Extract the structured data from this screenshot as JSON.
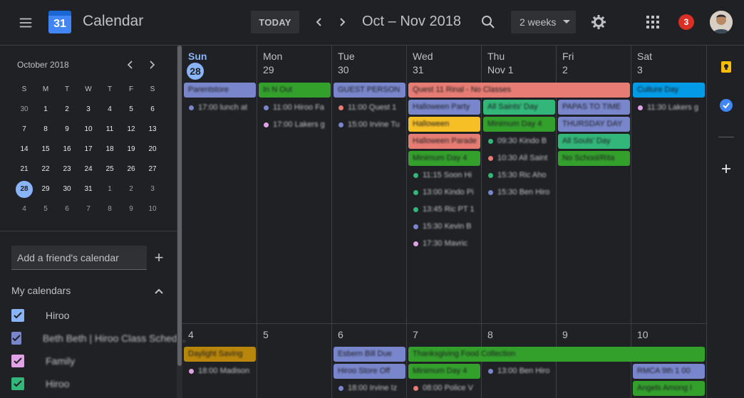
{
  "header": {
    "logo_day": "31",
    "app_title": "Calendar",
    "today_label": "TODAY",
    "date_range": "Oct – Nov 2018",
    "view_label": "2 weeks",
    "notification_count": "3"
  },
  "mini_calendar": {
    "title": "October 2018",
    "weekdays": [
      "S",
      "M",
      "T",
      "W",
      "T",
      "F",
      "S"
    ],
    "weeks": [
      [
        "30",
        "1",
        "2",
        "3",
        "4",
        "5",
        "6"
      ],
      [
        "7",
        "8",
        "9",
        "10",
        "11",
        "12",
        "13"
      ],
      [
        "14",
        "15",
        "16",
        "17",
        "18",
        "19",
        "20"
      ],
      [
        "21",
        "22",
        "23",
        "24",
        "25",
        "26",
        "27"
      ],
      [
        "28",
        "29",
        "30",
        "31",
        "1",
        "2",
        "3"
      ],
      [
        "4",
        "5",
        "6",
        "7",
        "8",
        "9",
        "10"
      ]
    ],
    "today": "28"
  },
  "sidebar": {
    "friend_placeholder": "Add a friend's calendar",
    "my_calendars_title": "My calendars",
    "calendars": [
      {
        "label": "Hiroo",
        "color": "#8ab4f8"
      },
      {
        "label": "Beth Beth | Hiroo Class Sched...",
        "color": "#7986cb"
      },
      {
        "label": "Family",
        "color": "#e1a3e5"
      },
      {
        "label": "Hiroo",
        "color": "#33b679"
      }
    ]
  },
  "week1": {
    "days": [
      {
        "dow": "Sun",
        "num": "28"
      },
      {
        "dow": "Mon",
        "num": "29"
      },
      {
        "dow": "Tue",
        "num": "30"
      },
      {
        "dow": "Wed",
        "num": "31"
      },
      {
        "dow": "Thu",
        "num": "Nov 1"
      },
      {
        "dow": "Fri",
        "num": "2"
      },
      {
        "dow": "Sat",
        "num": "3"
      }
    ],
    "events": [
      {
        "text": "Parentstore",
        "color": "#7986cb"
      },
      {
        "text": "In N Out",
        "color": "#33a02c"
      },
      {
        "text": "GUEST PERSON",
        "color": "#7986cb"
      },
      {
        "text": "Quest 11 Rinal - No Classes",
        "color": "#e67c73"
      },
      {
        "text": "Halloween Party",
        "color": "#7986cb"
      },
      {
        "text": "All Saints' Day",
        "color": "#33b679"
      },
      {
        "text": "PAPAS TO TIME",
        "color": "#7986cb"
      },
      {
        "text": "Culture Day",
        "color": "#039be5"
      },
      {
        "text": "Halloween",
        "color": "#f6bf26"
      },
      {
        "text": "Minimum Day 4",
        "color": "#33a02c"
      },
      {
        "text": "THURSDAY DAY",
        "color": "#7986cb"
      },
      {
        "text": "Halloween Parade",
        "color": "#e67c73"
      },
      {
        "text": "All Souls' Day",
        "color": "#33b679"
      },
      {
        "text": "Minimum Day 4",
        "color": "#33a02c"
      },
      {
        "text": "No School/Rita",
        "color": "#33a02c"
      }
    ],
    "timed": [
      {
        "text": "17:00 lunch at",
        "color": "#7986cb"
      },
      {
        "text": "11:00 Hiroo Fa",
        "color": "#7986cb"
      },
      {
        "text": "17:00 Lakers g",
        "color": "#e1a3e5"
      },
      {
        "text": "11:00 Quest 1",
        "color": "#e67c73"
      },
      {
        "text": "15:00 Irvine Tu",
        "color": "#7986cb"
      },
      {
        "text": "11:15 Soon Hi",
        "color": "#33b679"
      },
      {
        "text": "13:00 Kindo Pi",
        "color": "#33b679"
      },
      {
        "text": "13:45 Ric PT 1",
        "color": "#33b679"
      },
      {
        "text": "15:30 Kevin B",
        "color": "#7986cb"
      },
      {
        "text": "17:30 Mavric",
        "color": "#e1a3e5"
      },
      {
        "text": "09:30 Kindo B",
        "color": "#33b679"
      },
      {
        "text": "10:30 All Saint",
        "color": "#e67c73"
      },
      {
        "text": "15:30 Ric Aho",
        "color": "#33b679"
      },
      {
        "text": "15:30 Ben Hiro",
        "color": "#7986cb"
      },
      {
        "text": "11:30 Lakers g",
        "color": "#e1a3e5"
      }
    ]
  },
  "week2": {
    "days": [
      "4",
      "5",
      "6",
      "7",
      "8",
      "9",
      "10"
    ],
    "events": [
      {
        "text": "Daylight Saving",
        "color": "#b8860b"
      },
      {
        "text": "Esbern Bill Due",
        "color": "#7986cb"
      },
      {
        "text": "Thanksgiving Food Collection",
        "color": "#33a02c"
      },
      {
        "text": "Hiroo Store Off",
        "color": "#7986cb"
      },
      {
        "text": "Minimum Day 4",
        "color": "#33a02c"
      },
      {
        "text": "RMCA 9th 1 00",
        "color": "#7986cb"
      },
      {
        "text": "Angels Among I",
        "color": "#33a02c"
      }
    ],
    "timed": [
      {
        "text": "18:00 Madison",
        "color": "#e1a3e5"
      },
      {
        "text": "13:00 Ben Hiro",
        "color": "#7986cb"
      },
      {
        "text": "18:00 Irvine Iz",
        "color": "#7986cb"
      },
      {
        "text": "08:00 Police V",
        "color": "#e67c73"
      }
    ]
  }
}
